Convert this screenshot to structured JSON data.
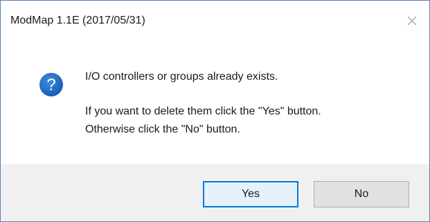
{
  "window": {
    "title": "ModMap 1.1E (2017/05/31)",
    "close_icon": "close-icon"
  },
  "message": {
    "icon": "question-icon",
    "line1": "I/O controllers or groups already exists.",
    "line2": "If you want to delete them click the \"Yes\" button.",
    "line3": "Otherwise click the \"No\" button."
  },
  "buttons": {
    "yes_label": "Yes",
    "no_label": "No"
  },
  "colors": {
    "accent": "#0078d7",
    "icon_blue": "#1e6fc8",
    "footer_bg": "#f0f0f0"
  }
}
